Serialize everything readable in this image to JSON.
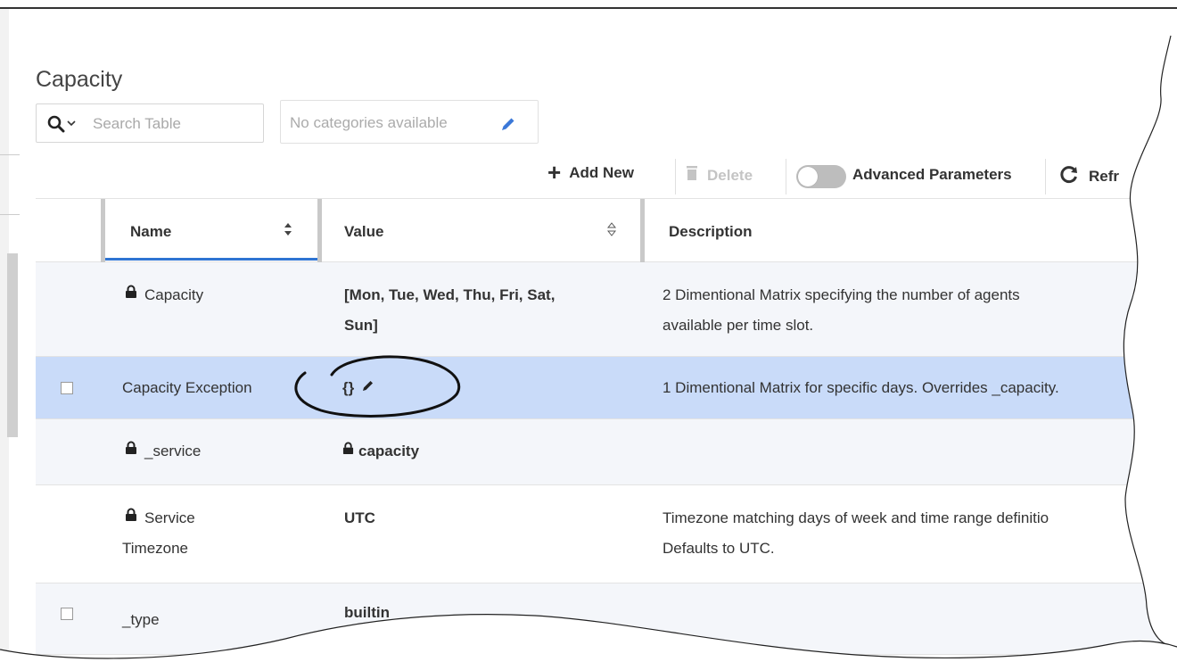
{
  "page": {
    "title": "Capacity"
  },
  "search": {
    "placeholder": "Search Table",
    "icon": "search-icon"
  },
  "categories": {
    "label": "No categories available",
    "icon": "pencil-icon"
  },
  "toolbar": {
    "add_label": "Add New",
    "delete_label": "Delete",
    "advanced_label": "Advanced Parameters",
    "advanced_enabled": false,
    "refresh_label": "Refr"
  },
  "table": {
    "columns": [
      {
        "label": "",
        "sortable": false
      },
      {
        "label": "Name",
        "sortable": true
      },
      {
        "label": "Value",
        "sortable": true
      },
      {
        "label": "Description",
        "sortable": false
      }
    ],
    "rows": [
      {
        "name": "Capacity",
        "locked": true,
        "value_line1": "[Mon, Tue, Wed, Thu, Fri, Sat,",
        "value_line2": "Sun]",
        "description_line1": "2 Dimentional Matrix specifying the number of agents",
        "description_line2": "available per time slot.",
        "checkbox": false
      },
      {
        "name": "Capacity Exception",
        "locked": false,
        "value": "{}",
        "editable": true,
        "description": "1 Dimentional Matrix for specific days. Overrides _capacity.",
        "checkbox": true,
        "selected": true
      },
      {
        "name": "_service",
        "locked": true,
        "value": "capacity",
        "value_locked": true,
        "description": "",
        "checkbox": false
      },
      {
        "name_line1": "Service",
        "name_line2": "Timezone",
        "locked": true,
        "value": "UTC",
        "description_line1": "Timezone matching days of week and time range definitio",
        "description_line2": "Defaults to UTC.",
        "checkbox": false
      },
      {
        "name": "_type",
        "locked": false,
        "value": "builtin",
        "description": "",
        "checkbox": true
      }
    ]
  },
  "colors": {
    "accent": "#2e74d3",
    "selected_row": "#c9dbf9",
    "alt_row": "#f4f6fa"
  }
}
